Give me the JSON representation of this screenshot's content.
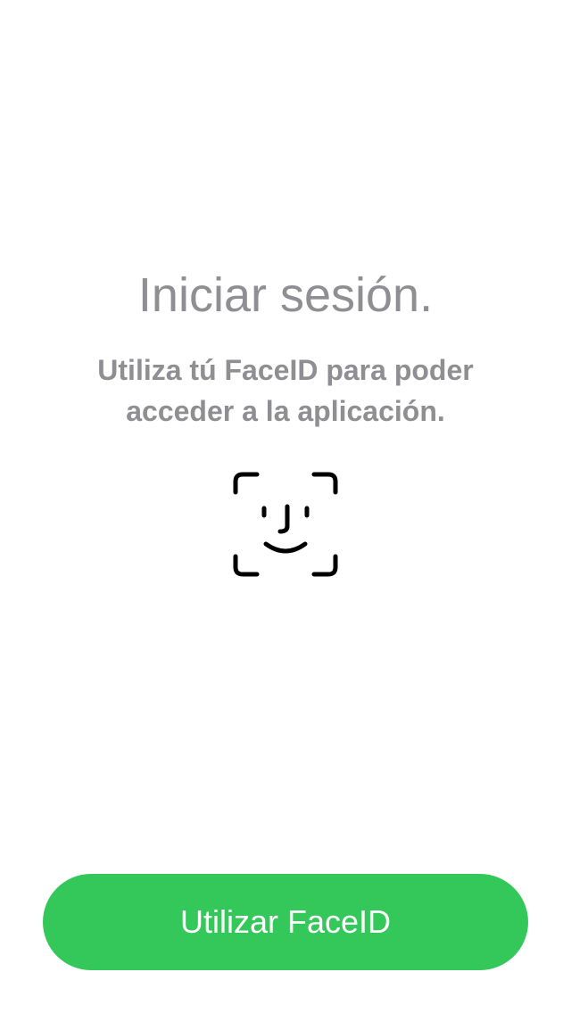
{
  "login": {
    "title": "Iniciar sesión.",
    "subtitle": "Utiliza tú FaceID para poder acceder a la aplicación.",
    "icon": "faceid-icon",
    "button_label": "Utilizar FaceID"
  },
  "colors": {
    "text_secondary": "#8e8e93",
    "accent": "#34c759",
    "background": "#ffffff",
    "icon": "#000000"
  }
}
